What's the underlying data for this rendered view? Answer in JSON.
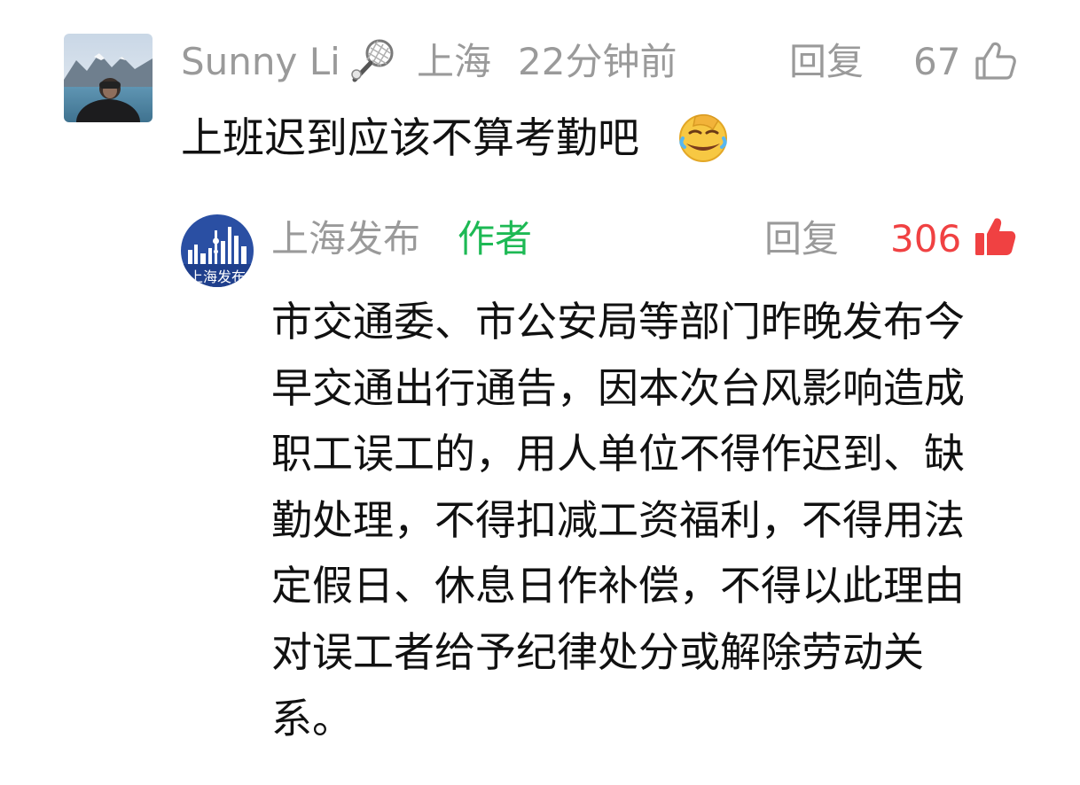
{
  "comment": {
    "user_name": "Sunny Li",
    "location": "上海",
    "time": "22分钟前",
    "reply_label": "回复",
    "like_count": "67",
    "text": "上班迟到应该不算考勤吧",
    "name_emoji_icon": "badminton-racket-icon",
    "text_emoji_icon": "face-palm-laughing-icon"
  },
  "reply": {
    "user_name": "上海发布",
    "author_badge": "作者",
    "reply_label": "回复",
    "like_count": "306",
    "avatar_text": "上海发布",
    "text": "市交通委、市公安局等部门昨晚发布今早交通出行通告，因本次台风影响造成职工误工的，用人单位不得作迟到、缺勤处理，不得扣减工资福利，不得用法定假日、休息日作补偿，不得以此理由对误工者给予纪律处分或解除劳动关系。"
  },
  "colors": {
    "meta_gray": "#9a9a9a",
    "author_green": "#1db954",
    "like_red": "#f04142",
    "official_blue": "#2a4fa3"
  }
}
